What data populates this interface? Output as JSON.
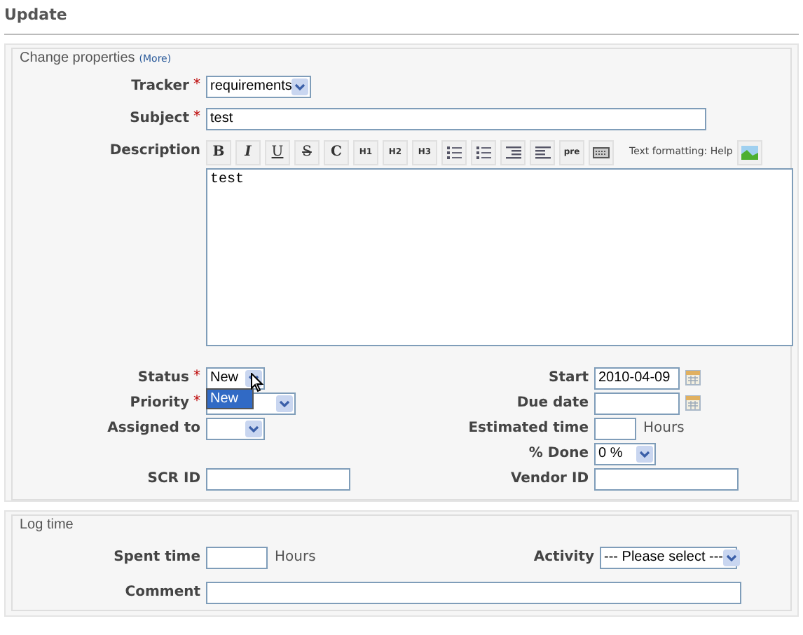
{
  "heading": "Update",
  "properties": {
    "legend": "Change properties",
    "more_link": "(More)",
    "tracker": {
      "label": "Tracker",
      "mark": "*",
      "value": "requirements"
    },
    "subject": {
      "label": "Subject",
      "mark": "*",
      "value": "test"
    },
    "description": {
      "label": "Description",
      "value": "test",
      "help_label": "Text formatting:",
      "help_link": "Help",
      "toolbar": [
        {
          "kind": "bold",
          "text": "B"
        },
        {
          "kind": "italic",
          "text": "I"
        },
        {
          "kind": "underline",
          "text": "U"
        },
        {
          "kind": "strike",
          "text": "S"
        },
        {
          "kind": "bold",
          "text": "C"
        },
        {
          "kind": "heading",
          "text": "H1"
        },
        {
          "kind": "heading",
          "text": "H2"
        },
        {
          "kind": "heading",
          "text": "H3"
        },
        {
          "kind": "bullets"
        },
        {
          "kind": "numbers"
        },
        {
          "kind": "indent"
        },
        {
          "kind": "outdent"
        },
        {
          "kind": "heading",
          "text": "pre"
        },
        {
          "kind": "keyboard"
        },
        {
          "kind": "image"
        }
      ]
    },
    "left": [
      {
        "kind": "select",
        "label": "Status",
        "mark": "*",
        "value": "New",
        "open": true,
        "options": [
          {
            "label": "New",
            "selected": true
          }
        ]
      },
      {
        "kind": "select",
        "label": "Priority",
        "mark": "*"
      },
      {
        "kind": "select",
        "label": "Assigned to"
      },
      {
        "kind": "blank"
      },
      {
        "kind": "text",
        "label": "SCR ID"
      }
    ],
    "right": [
      {
        "kind": "date",
        "label": "Start",
        "value": "2010-04-09"
      },
      {
        "kind": "date",
        "label": "Due date"
      },
      {
        "kind": "hours",
        "label": "Estimated time",
        "unit": "Hours"
      },
      {
        "kind": "select",
        "label": "% Done",
        "value": "0 %"
      },
      {
        "kind": "text",
        "label": "Vendor ID"
      }
    ]
  },
  "log_time": {
    "legend": "Log time",
    "spent": {
      "label": "Spent time",
      "unit": "Hours"
    },
    "activity": {
      "label": "Activity",
      "value": "--- Please select ---"
    },
    "comment": {
      "label": "Comment"
    }
  }
}
